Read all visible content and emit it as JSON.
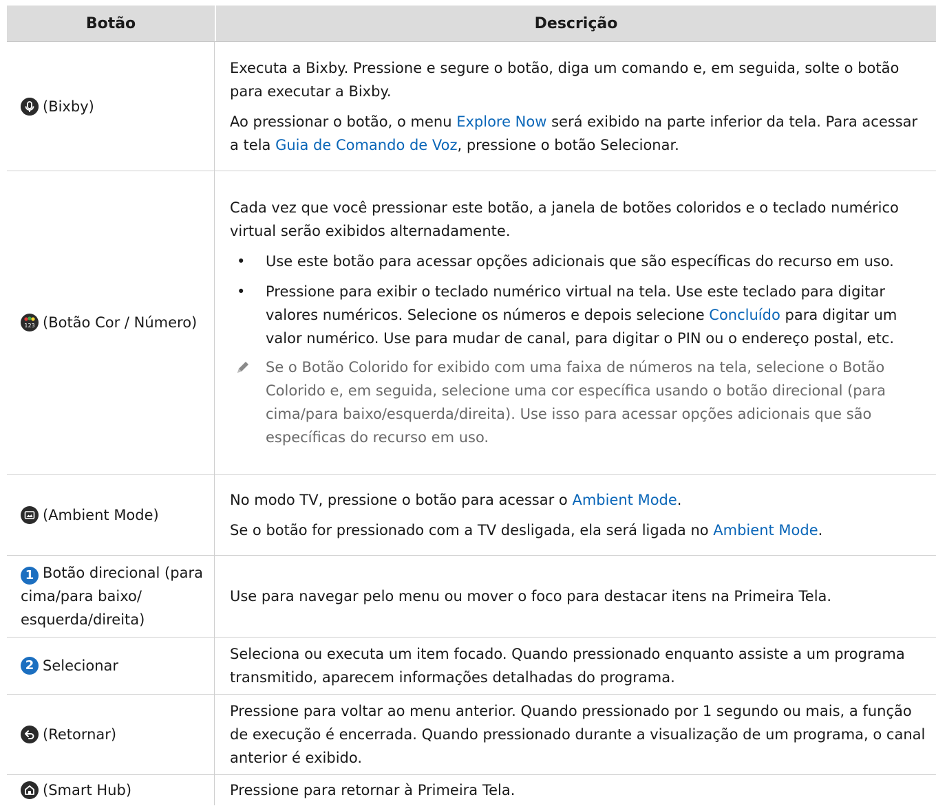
{
  "header": {
    "col1": "Botão",
    "col2": "Descrição"
  },
  "rows": [
    {
      "label": "(Bixby)",
      "icon": "microphone-icon",
      "p1": "Executa a Bixby. Pressione e segure o botão, diga um comando e, em seguida, solte o botão para executar a Bixby.",
      "p2a": "Ao pressionar o botão, o menu ",
      "p2link1": "Explore Now",
      "p2b": " será exibido na parte inferior da tela. Para acessar a tela ",
      "p2link2": "Guia de Comando de Voz",
      "p2c": ", pressione o botão Selecionar."
    },
    {
      "label": "(Botão Cor / Número)",
      "icon": "color-number-icon",
      "p1": "Cada vez que você pressionar este botão, a janela de botões coloridos e o teclado numérico virtual serão exibidos alternadamente.",
      "b1": "Use este botão para acessar opções adicionais que são específicas do recurso em uso.",
      "b2a": "Pressione para exibir o teclado numérico virtual na tela. Use este teclado para digitar valores numéricos. Selecione os números e depois selecione ",
      "b2link": "Concluído",
      "b2b": " para digitar um valor numérico. Use para mudar de canal, para digitar o PIN ou o endereço postal, etc.",
      "note": "Se o Botão Colorido for exibido com uma faixa de números na tela, selecione o Botão Colorido e, em seguida, selecione uma cor específica usando o botão direcional (para cima/para baixo/esquerda/direita). Use isso para acessar opções adicionais que são específicas do recurso em uso."
    },
    {
      "label": "(Ambient Mode)",
      "icon": "ambient-mode-icon",
      "p1a": "No modo TV, pressione o botão para acessar o ",
      "p1link": "Ambient Mode",
      "p1b": ".",
      "p2a": "Se o botão for pressionado com a TV desligada, ela será ligada no ",
      "p2link": "Ambient Mode",
      "p2b": "."
    },
    {
      "num": "1",
      "label": "Botão direcional (para cima/para baixo/ esquerda/direita)",
      "p1": "Use para navegar pelo menu ou mover o foco para destacar itens na Primeira Tela."
    },
    {
      "num": "2",
      "label": "Selecionar",
      "p1": "Seleciona ou executa um item focado. Quando pressionado enquanto assiste a um programa transmitido, aparecem informações detalhadas do programa."
    },
    {
      "label": "(Retornar)",
      "icon": "return-icon",
      "p1": "Pressione para voltar ao menu anterior. Quando pressionado por 1 segundo ou mais, a função de execução é encerrada. Quando pressionado durante a visualização de um programa, o canal anterior é exibido."
    },
    {
      "label": "(Smart Hub)",
      "icon": "home-icon",
      "p1": "Pressione para retornar à Primeira Tela."
    }
  ]
}
